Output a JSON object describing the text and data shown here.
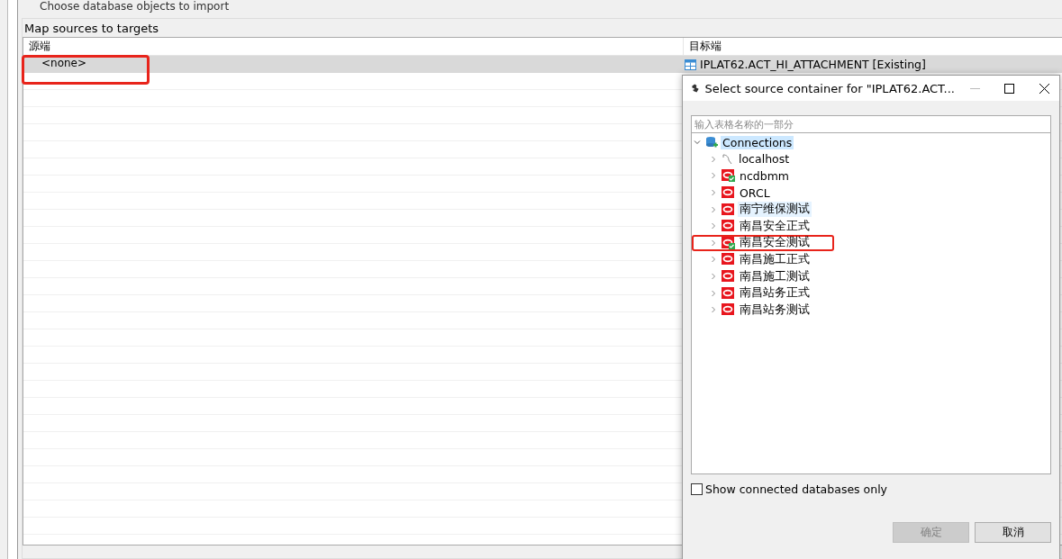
{
  "window": {
    "title": "Choose database objects to import"
  },
  "group": {
    "title": "Map sources to targets"
  },
  "table": {
    "columns": [
      "源端",
      "目标端"
    ],
    "rows": [
      {
        "source": "<none>",
        "target": "IPLAT62.ACT_HI_ATTACHMENT [Existing]",
        "selected": true
      }
    ]
  },
  "dialog": {
    "title": "Select source container for \"IPLAT62.ACT...",
    "filter": {
      "placeholder": "输入表格名称的一部分"
    },
    "tree": [
      {
        "label": "Connections",
        "kind": "folder",
        "expanded": true,
        "selected": true,
        "children": [
          {
            "label": "localhost",
            "kind": "host",
            "connected": false,
            "hovered": false
          },
          {
            "label": "ncdbmm",
            "kind": "oracle",
            "connected": true,
            "hovered": false
          },
          {
            "label": "ORCL",
            "kind": "oracle",
            "connected": false,
            "hovered": false
          },
          {
            "label": "南宁维保测试",
            "kind": "oracle",
            "connected": false,
            "hovered": true
          },
          {
            "label": "南昌安全正式",
            "kind": "oracle",
            "connected": false,
            "hovered": false
          },
          {
            "label": "南昌安全测试",
            "kind": "oracle",
            "connected": true,
            "hovered": false,
            "highlighted": true
          },
          {
            "label": "南昌施工正式",
            "kind": "oracle",
            "connected": false,
            "hovered": false
          },
          {
            "label": "南昌施工测试",
            "kind": "oracle",
            "connected": false,
            "hovered": false
          },
          {
            "label": "南昌站务正式",
            "kind": "oracle",
            "connected": false,
            "hovered": false
          },
          {
            "label": "南昌站务测试",
            "kind": "oracle",
            "connected": false,
            "hovered": false
          }
        ]
      }
    ],
    "checkbox": {
      "label": "Show connected databases only",
      "checked": false
    },
    "buttons": [
      {
        "label": "确定",
        "disabled": true
      },
      {
        "label": "取消",
        "disabled": false
      }
    ]
  }
}
